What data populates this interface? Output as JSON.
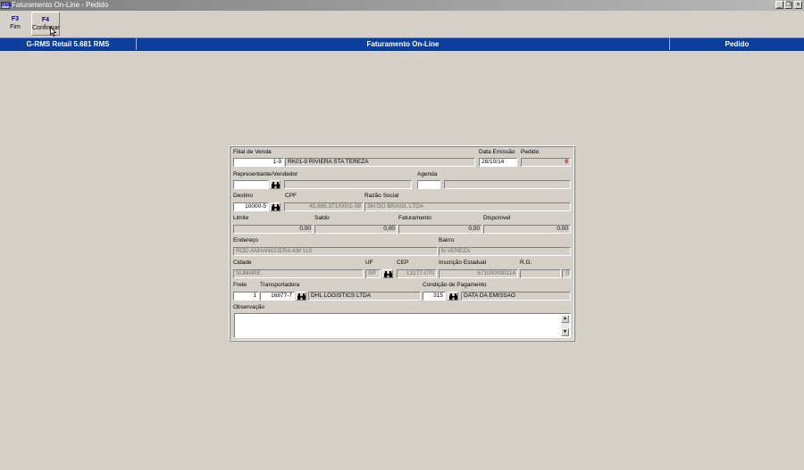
{
  "window": {
    "title": "Faturamento On-Line - Pedido",
    "icon_text": "RMS"
  },
  "window_controls": {
    "minimize": "_",
    "restore": "❐",
    "close": "×"
  },
  "toolbar": {
    "buttons": [
      {
        "key": "F3",
        "label": "Fim"
      },
      {
        "key": "F4",
        "label": "Confirmar"
      }
    ]
  },
  "status": {
    "system": "G-RMS Retail 5.681 RMS",
    "module": "Faturamento On-Line",
    "screen": "Pedido"
  },
  "form": {
    "filial_label": "Filial de Venda",
    "filial_code": "1-9",
    "filial_name": "RK01-9 RIVIERA STA TEREZA",
    "data_emissao_label": "Data Emissão",
    "data_emissao": "28/10/14",
    "pedido_label": "Pedido",
    "pedido": "0",
    "representante_label": "Representante/Vendedor",
    "representante_code": "",
    "representante_name": "",
    "agenda_label": "Agenda",
    "agenda_code": "",
    "agenda_desc": "",
    "destino_label": "Destino",
    "destino": "10000-5",
    "cpf_label": "CPF",
    "cpf": "45.985.371/0001-08",
    "razao_label": "Razão Social",
    "razao": "3M DO BRASIL LTDA",
    "limite_label": "Limite",
    "limite": "0,00",
    "saldo_label": "Saldo",
    "saldo": "0,00",
    "faturamento_label": "Faturamento",
    "faturamento": "0,00",
    "disponivel_label": "Disponível",
    "disponivel": "0,00",
    "endereco_label": "Endereço",
    "endereco": "ROD ANHANGUERA KM 110",
    "bairro_label": "Bairro",
    "bairro": "N VENEZA",
    "cidade_label": "Cidade",
    "cidade": "SUMARE",
    "uf_label": "UF",
    "uf": "SP",
    "cep_label": "CEP",
    "cep": "13177-070",
    "ie_label": "Inscrição Estadual",
    "ie": "671000090114",
    "rg_label": "R.G.",
    "rg": "",
    "rg_num": "0",
    "frete_label": "Frete",
    "frete": "1",
    "transportadora_label": "Transportadora",
    "transportadora_code": "16877-7",
    "transportadora_name": "DHL LOGISTICS LTDA",
    "condicao_label": "Condição de Pagamento",
    "condicao_code": "315",
    "condicao_desc": "DATA DA EMISSAO",
    "observacao_label": "Observação",
    "observacao": "",
    "scroll_up": "▲",
    "scroll_down": "▼"
  },
  "colors": {
    "title_bar": "#808080",
    "status_bar": "#0a3f9e",
    "background": "#d4d0c8",
    "pedido_value": "#c00000"
  },
  "icons": [
    "binoculars-icon",
    "mouse-cursor-icon"
  ]
}
